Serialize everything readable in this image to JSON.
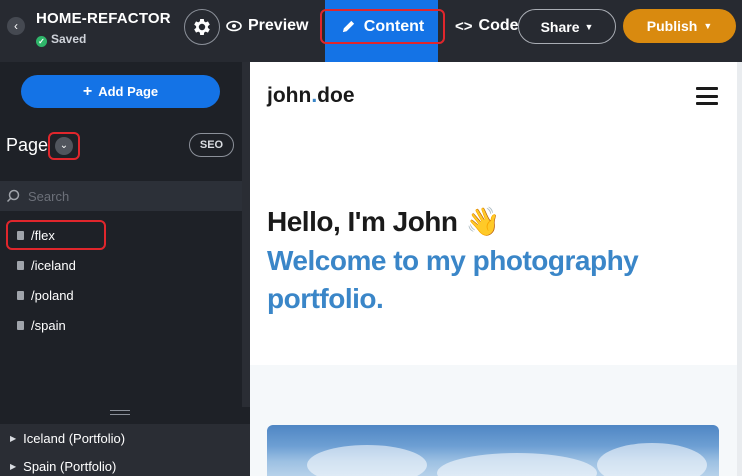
{
  "topbar": {
    "project_name": "HOME-REFACTOR",
    "status": "Saved",
    "preview_label": "Preview",
    "content_label": "Content",
    "code_label": "Code",
    "share_label": "Share",
    "publish_label": "Publish"
  },
  "sidebar": {
    "add_page_label": "Add Page",
    "page_label": "Page",
    "seo_label": "SEO",
    "search_placeholder": "Search",
    "pages": [
      "/flex",
      "/iceland",
      "/poland",
      "/spain"
    ],
    "active_page": "/flex",
    "groups": [
      "Iceland (Portfolio)",
      "Spain (Portfolio)"
    ]
  },
  "preview": {
    "logo_name": "john",
    "logo_dot": ".",
    "logo_suffix": "doe",
    "hero_title": "Hello, I'm John",
    "hero_emoji": "👋",
    "hero_subtitle": "Welcome to my photography portfolio."
  },
  "colors": {
    "accent": "#1473e6",
    "publish": "#d98a0f",
    "highlight": "#e0262c",
    "brand_blue": "#3a86c8"
  }
}
